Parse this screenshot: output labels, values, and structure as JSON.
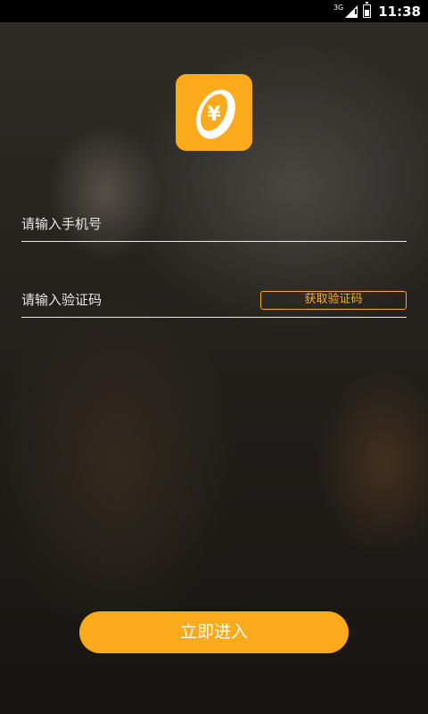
{
  "status_bar": {
    "network": "3G",
    "time": "11:38"
  },
  "logo": {
    "icon": "yen-coin-icon",
    "symbol": "¥"
  },
  "form": {
    "phone_placeholder": "请输入手机号",
    "code_placeholder": "请输入验证码",
    "get_code_label": "获取验证码",
    "submit_label": "立即进入"
  },
  "colors": {
    "accent": "#FBAA1B",
    "underline": "#E9E9E9",
    "placeholder": "#E7E7E7"
  }
}
